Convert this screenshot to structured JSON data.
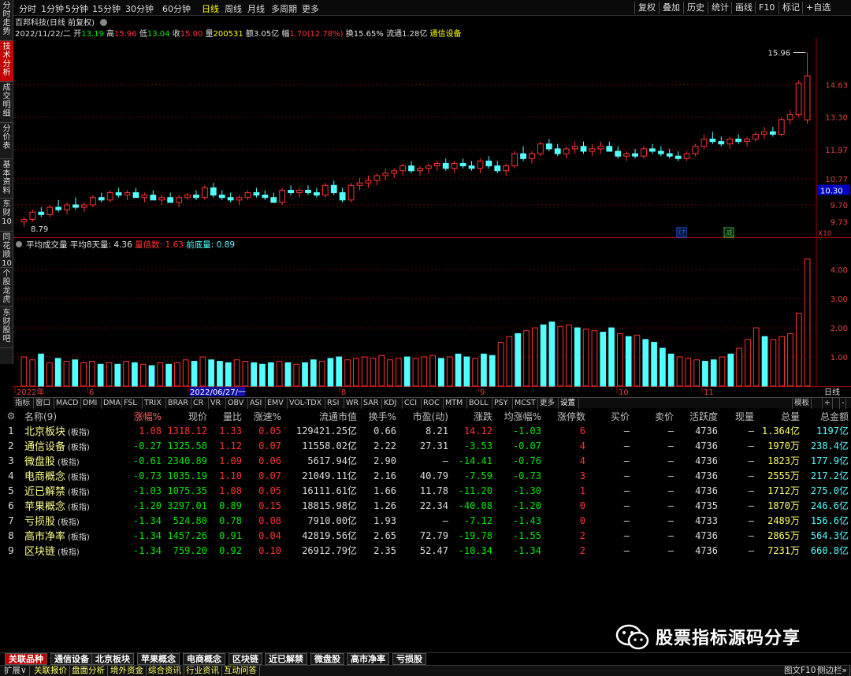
{
  "sidebar_left": [
    {
      "label": "分时走势",
      "active": false
    },
    {
      "label": "技术分析",
      "active": true
    },
    {
      "label": "成交明细",
      "active": false
    },
    {
      "label": "分价表",
      "active": false
    },
    {
      "label": "基本资料",
      "active": false
    },
    {
      "label": "东财10",
      "active": false
    },
    {
      "label": "同花顺10",
      "active": false
    },
    {
      "label": "个股龙虎",
      "active": false
    },
    {
      "label": "东财股吧",
      "active": false
    }
  ],
  "periods": [
    "分时",
    "1分钟",
    "5分钟",
    "15分钟",
    "30分钟",
    "60分钟",
    "日线",
    "周线",
    "月线",
    "多周期",
    "更多"
  ],
  "active_period": "日线",
  "toolbar_buttons": [
    "复权",
    "叠加",
    "历史",
    "统计",
    "画线",
    "F10",
    "标记",
    "+自选"
  ],
  "stock": {
    "title": "百邦科技(日线 前复权)",
    "date": "2022/11/22/二",
    "open_label": "开",
    "open": "13.19",
    "high_label": "高",
    "high": "15.96",
    "low_label": "低",
    "low": "13.04",
    "close_label": "收",
    "close": "15.00",
    "vol_label": "量",
    "vol": "200531",
    "amount_label": "额",
    "amount": "3.05亿",
    "change_label": "幅",
    "change": "1.70(12.78%)",
    "turnover_label": "换",
    "turnover": "15.65%",
    "float_label": "流通",
    "float": "1.28亿",
    "industry": "通信设备"
  },
  "price_axis": [
    "14.63",
    "13.30",
    "11.97",
    "10.77",
    "9.70",
    "9.73"
  ],
  "price_axis_current": "10.30",
  "price_annot_high": "15.96",
  "price_annot_low": "8.79",
  "chart_badges": [
    "财",
    "减"
  ],
  "x10_label": "X10",
  "volume_indicator": {
    "name": "平均成交量",
    "avg_label": "平均8天量:",
    "avg": "4.36",
    "ratio_label": "量倍数:",
    "ratio": "1.63",
    "base_label": "前底量:",
    "base": "0.89"
  },
  "volume_axis": [
    "4.00",
    "3.00",
    "2.00",
    "1.00"
  ],
  "time_axis": [
    "2022年",
    "6",
    "2022/06/27/一",
    "8",
    "9",
    "10",
    "11"
  ],
  "time_axis_right": "日线",
  "indicator_tabs": [
    "指标",
    "窗口",
    "MACD",
    "DMI",
    "DMA",
    "FSL",
    "TRIX",
    "BRAR",
    "CR",
    "VR",
    "OBV",
    "ASI",
    "EMV",
    "VOL-TDX",
    "RSI",
    "WR",
    "SAR",
    "KDJ",
    "CCI",
    "ROC",
    "MTM",
    "BOLL",
    "PSY",
    "MCST",
    "更多",
    "设置"
  ],
  "indicator_right": [
    "模板",
    "+",
    "-"
  ],
  "chart_data": {
    "type": "candlestick",
    "title": "百邦科技(日线 前复权)",
    "ylim": [
      8.6,
      16.3
    ],
    "candles": [
      [
        9.0,
        9.2,
        8.8,
        9.1
      ],
      [
        9.1,
        9.5,
        9.0,
        9.4
      ],
      [
        9.4,
        9.6,
        9.2,
        9.3
      ],
      [
        9.3,
        9.7,
        9.2,
        9.6
      ],
      [
        9.6,
        9.9,
        9.4,
        9.5
      ],
      [
        9.5,
        9.8,
        9.3,
        9.7
      ],
      [
        9.7,
        10.0,
        9.5,
        9.6
      ],
      [
        9.6,
        9.8,
        9.4,
        9.7
      ],
      [
        9.7,
        10.1,
        9.6,
        10.0
      ],
      [
        10.0,
        10.2,
        9.8,
        9.9
      ],
      [
        9.9,
        10.3,
        9.8,
        10.2
      ],
      [
        10.2,
        10.4,
        10.0,
        10.1
      ],
      [
        10.1,
        10.3,
        9.9,
        10.2
      ],
      [
        10.2,
        10.4,
        10.0,
        10.0
      ],
      [
        10.0,
        10.2,
        9.8,
        10.1
      ],
      [
        10.1,
        10.3,
        9.9,
        9.9
      ],
      [
        9.9,
        10.1,
        9.7,
        10.0
      ],
      [
        10.0,
        10.2,
        9.8,
        9.8
      ],
      [
        9.8,
        10.1,
        9.6,
        10.0
      ],
      [
        10.0,
        10.2,
        9.9,
        10.1
      ],
      [
        10.1,
        10.3,
        9.9,
        10.0
      ],
      [
        10.0,
        10.5,
        9.9,
        10.4
      ],
      [
        10.4,
        10.6,
        10.0,
        10.1
      ],
      [
        10.1,
        10.3,
        9.9,
        10.0
      ],
      [
        10.0,
        10.2,
        9.8,
        9.9
      ],
      [
        9.9,
        10.1,
        9.7,
        10.0
      ],
      [
        10.0,
        10.3,
        9.9,
        10.2
      ],
      [
        10.2,
        10.4,
        10.0,
        10.1
      ],
      [
        10.1,
        10.3,
        9.9,
        10.0
      ],
      [
        10.0,
        10.2,
        9.8,
        9.8
      ],
      [
        9.8,
        10.4,
        9.7,
        10.3
      ],
      [
        10.3,
        10.5,
        10.1,
        10.2
      ],
      [
        10.2,
        10.4,
        10.0,
        10.3
      ],
      [
        10.3,
        10.5,
        10.1,
        10.2
      ],
      [
        10.2,
        10.4,
        10.0,
        10.1
      ],
      [
        10.1,
        10.6,
        10.0,
        10.5
      ],
      [
        10.5,
        10.7,
        10.1,
        10.2
      ],
      [
        10.2,
        10.4,
        9.8,
        9.9
      ],
      [
        9.9,
        10.6,
        9.8,
        10.5
      ],
      [
        10.5,
        10.8,
        10.3,
        10.6
      ],
      [
        10.6,
        10.9,
        10.4,
        10.7
      ],
      [
        10.7,
        11.0,
        10.5,
        10.9
      ],
      [
        10.9,
        11.2,
        10.7,
        11.0
      ],
      [
        11.0,
        11.2,
        10.8,
        11.1
      ],
      [
        11.1,
        11.4,
        10.9,
        11.3
      ],
      [
        11.3,
        11.5,
        11.0,
        11.1
      ],
      [
        11.1,
        11.3,
        10.9,
        11.2
      ],
      [
        11.2,
        11.4,
        11.0,
        11.3
      ],
      [
        11.3,
        11.5,
        11.1,
        11.4
      ],
      [
        11.4,
        11.6,
        11.1,
        11.2
      ],
      [
        11.2,
        11.5,
        11.0,
        11.4
      ],
      [
        11.4,
        11.6,
        11.2,
        11.3
      ],
      [
        11.3,
        11.5,
        11.1,
        11.2
      ],
      [
        11.2,
        11.6,
        11.0,
        11.5
      ],
      [
        11.5,
        11.7,
        11.2,
        11.3
      ],
      [
        11.3,
        11.5,
        11.0,
        11.1
      ],
      [
        11.1,
        11.4,
        10.9,
        11.3
      ],
      [
        11.3,
        11.9,
        11.2,
        11.8
      ],
      [
        11.8,
        12.1,
        11.5,
        11.6
      ],
      [
        11.6,
        11.9,
        11.4,
        11.8
      ],
      [
        11.8,
        12.3,
        11.7,
        12.2
      ],
      [
        12.2,
        12.4,
        11.9,
        12.0
      ],
      [
        12.0,
        12.2,
        11.7,
        11.8
      ],
      [
        11.8,
        12.1,
        11.6,
        12.0
      ],
      [
        12.0,
        12.3,
        11.8,
        12.1
      ],
      [
        12.1,
        12.3,
        11.8,
        11.9
      ],
      [
        11.9,
        12.2,
        11.7,
        12.0
      ],
      [
        12.0,
        12.3,
        11.8,
        12.1
      ],
      [
        12.1,
        12.3,
        11.9,
        11.9
      ],
      [
        11.9,
        12.1,
        11.6,
        11.7
      ],
      [
        11.7,
        11.9,
        11.5,
        11.8
      ],
      [
        11.8,
        12.0,
        11.6,
        11.7
      ],
      [
        11.7,
        12.1,
        11.6,
        12.0
      ],
      [
        12.0,
        12.2,
        11.8,
        11.9
      ],
      [
        11.9,
        12.1,
        11.7,
        11.8
      ],
      [
        11.8,
        12.0,
        11.6,
        11.7
      ],
      [
        11.7,
        11.9,
        11.5,
        11.6
      ],
      [
        11.6,
        11.9,
        11.5,
        11.8
      ],
      [
        11.8,
        12.2,
        11.7,
        12.1
      ],
      [
        12.1,
        12.6,
        12.0,
        12.4
      ],
      [
        12.4,
        12.7,
        12.2,
        12.3
      ],
      [
        12.3,
        12.5,
        12.1,
        12.2
      ],
      [
        12.2,
        12.5,
        12.0,
        12.4
      ],
      [
        12.4,
        12.6,
        12.2,
        12.3
      ],
      [
        12.3,
        12.5,
        12.1,
        12.4
      ],
      [
        12.4,
        12.7,
        12.3,
        12.6
      ],
      [
        12.6,
        12.9,
        12.4,
        12.7
      ],
      [
        12.7,
        12.9,
        12.5,
        12.6
      ],
      [
        12.6,
        13.3,
        12.5,
        13.2
      ],
      [
        13.2,
        13.6,
        13.0,
        13.4
      ],
      [
        13.4,
        14.8,
        13.3,
        14.7
      ],
      [
        13.19,
        15.96,
        13.04,
        15.0
      ]
    ]
  },
  "volume_bars": [
    1.0,
    0.9,
    1.1,
    0.8,
    0.95,
    0.85,
    0.9,
    0.8,
    0.85,
    0.75,
    0.8,
    0.75,
    0.85,
    0.8,
    0.75,
    0.7,
    0.8,
    0.75,
    0.8,
    0.9,
    0.85,
    1.0,
    0.9,
    0.85,
    0.8,
    0.9,
    0.85,
    0.8,
    0.75,
    0.8,
    0.85,
    0.8,
    0.75,
    0.8,
    0.9,
    0.85,
    0.95,
    1.0,
    0.9,
    0.95,
    1.0,
    0.95,
    1.05,
    0.9,
    0.95,
    1.0,
    0.95,
    1.0,
    1.05,
    0.95,
    1.0,
    1.1,
    1.0,
    0.95,
    1.1,
    1.05,
    1.5,
    1.7,
    1.8,
    1.9,
    2.0,
    2.1,
    2.2,
    2.05,
    2.1,
    2.0,
    1.95,
    1.9,
    1.85,
    2.0,
    1.8,
    1.7,
    1.75,
    1.6,
    1.5,
    1.3,
    1.1,
    1.0,
    0.95,
    0.9,
    0.85,
    0.9,
    1.0,
    1.1,
    1.3,
    1.6,
    2.0,
    1.7,
    1.6,
    1.7,
    1.8,
    2.5,
    4.36
  ],
  "table": {
    "columns": [
      "名称(9)",
      "涨幅%",
      "现价",
      "量比",
      "涨速%",
      "流通市值",
      "换手%",
      "市盈(动)",
      "涨跌",
      "均涨幅%",
      "涨停数",
      "买价",
      "卖价",
      "活跃度",
      "现量",
      "总量",
      "总金额"
    ],
    "rows": [
      {
        "idx": "1",
        "name": "北京板块",
        "tag": "(板指)",
        "chg": "1.08",
        "price": "1318.12",
        "volr": "1.33",
        "speed": "0.05",
        "cap": "129421.25亿",
        "turn": "0.66",
        "pe": "8.21",
        "diff": "14.12",
        "avg": "-1.03",
        "limit": "6",
        "bid": "—",
        "ask": "—",
        "act": "4736",
        "cur": "—",
        "total": "1.364亿",
        "amount": "1197亿",
        "dir": "up"
      },
      {
        "idx": "2",
        "name": "通信设备",
        "tag": "(板指)",
        "chg": "-0.27",
        "price": "1325.58",
        "volr": "1.12",
        "speed": "0.07",
        "cap": "11558.02亿",
        "turn": "2.22",
        "pe": "27.31",
        "diff": "-3.53",
        "avg": "-0.07",
        "limit": "4",
        "bid": "—",
        "ask": "—",
        "act": "4736",
        "cur": "—",
        "total": "1970万",
        "amount": "238.4亿",
        "dir": "down"
      },
      {
        "idx": "3",
        "name": "微盘股",
        "tag": "(板指)",
        "chg": "-0.61",
        "price": "2340.89",
        "volr": "1.09",
        "speed": "0.06",
        "cap": "5617.94亿",
        "turn": "2.90",
        "pe": "—",
        "diff": "-14.41",
        "avg": "-0.76",
        "limit": "4",
        "bid": "—",
        "ask": "—",
        "act": "4736",
        "cur": "—",
        "total": "1823万",
        "amount": "177.9亿",
        "dir": "down"
      },
      {
        "idx": "4",
        "name": "电商概念",
        "tag": "(板指)",
        "chg": "-0.73",
        "price": "1035.19",
        "volr": "1.10",
        "speed": "0.07",
        "cap": "21049.11亿",
        "turn": "2.16",
        "pe": "40.79",
        "diff": "-7.59",
        "avg": "-0.73",
        "limit": "3",
        "bid": "—",
        "ask": "—",
        "act": "4736",
        "cur": "—",
        "total": "2555万",
        "amount": "217.2亿",
        "dir": "down"
      },
      {
        "idx": "5",
        "name": "近已解禁",
        "tag": "(板指)",
        "chg": "-1.03",
        "price": "1075.35",
        "volr": "1.08",
        "speed": "0.05",
        "cap": "16111.61亿",
        "turn": "1.66",
        "pe": "11.78",
        "diff": "-11.20",
        "avg": "-1.30",
        "limit": "1",
        "bid": "—",
        "ask": "—",
        "act": "4736",
        "cur": "—",
        "total": "1712万",
        "amount": "275.0亿",
        "dir": "down"
      },
      {
        "idx": "6",
        "name": "苹果概念",
        "tag": "(板指)",
        "chg": "-1.20",
        "price": "3297.01",
        "volr": "0.89",
        "speed": "0.15",
        "cap": "18815.98亿",
        "turn": "1.26",
        "pe": "22.34",
        "diff": "-40.08",
        "avg": "-1.20",
        "limit": "0",
        "bid": "—",
        "ask": "—",
        "act": "4735",
        "cur": "—",
        "total": "1870万",
        "amount": "246.6亿",
        "dir": "down"
      },
      {
        "idx": "7",
        "name": "亏损股",
        "tag": "(板指)",
        "chg": "-1.34",
        "price": "524.80",
        "volr": "0.78",
        "speed": "0.08",
        "cap": "7910.00亿",
        "turn": "1.93",
        "pe": "—",
        "diff": "-7.12",
        "avg": "-1.43",
        "limit": "0",
        "bid": "—",
        "ask": "—",
        "act": "4733",
        "cur": "—",
        "total": "2489万",
        "amount": "156.6亿",
        "dir": "down"
      },
      {
        "idx": "8",
        "name": "高市净率",
        "tag": "(板指)",
        "chg": "-1.34",
        "price": "1457.26",
        "volr": "0.91",
        "speed": "0.04",
        "cap": "42819.56亿",
        "turn": "2.65",
        "pe": "72.79",
        "diff": "-19.78",
        "avg": "-1.55",
        "limit": "2",
        "bid": "—",
        "ask": "—",
        "act": "4736",
        "cur": "—",
        "total": "2865万",
        "amount": "564.3亿",
        "dir": "down"
      },
      {
        "idx": "9",
        "name": "区块链",
        "tag": "(板指)",
        "chg": "-1.34",
        "price": "759.20",
        "volr": "0.92",
        "speed": "0.10",
        "cap": "26912.79亿",
        "turn": "2.35",
        "pe": "52.47",
        "diff": "-10.34",
        "avg": "-1.34",
        "limit": "2",
        "bid": "—",
        "ask": "—",
        "act": "4736",
        "cur": "—",
        "total": "7231万",
        "amount": "660.8亿",
        "dir": "down"
      }
    ]
  },
  "bottom_tabs": [
    "关联品种",
    "通信设备",
    "北京板块",
    "苹果概念",
    "电商概念",
    "区块链",
    "近已解禁",
    "微盘股",
    "高市净率",
    "亏损股"
  ],
  "status_items": [
    "扩展∨",
    "关联报价",
    "盘面分析",
    "境外资金",
    "综合资讯",
    "行业资讯",
    "互动问答"
  ],
  "status_right": [
    "图文F10",
    "侧边栏»"
  ],
  "watermark": "股票指标源码分享",
  "colors": {
    "up": "#ff3232",
    "down": "#54ffff",
    "active_tab": "#c00000",
    "name": "#ffff8c"
  }
}
